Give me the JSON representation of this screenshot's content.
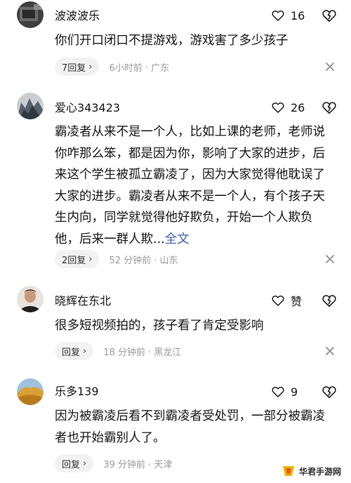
{
  "colors": {
    "text": "#161616",
    "meta": "#9b9b9b",
    "link": "#3b63a8",
    "chip_bg": "#f2f2f2"
  },
  "comments": [
    {
      "username": "波波波乐",
      "avatar_icon": "avatar-photo",
      "like_count": "16",
      "text": "你们开口闭口不提游戏，游戏害了多少孩子",
      "reply_label": "7回复",
      "meta": "6小时前 · 广东"
    },
    {
      "username": "爱心343423",
      "avatar_icon": "avatar-photo",
      "like_count": "26",
      "text": "霸凌者从来不是一个人，比如上课的老师，老师说你咋那么笨，都是因为你，影响了大家的进步，后来这个学生被孤立霸凌了，因为大家觉得他耽误了大家的进步。霸凌者从来不是一个人，有个孩子天生内向，同学就觉得他好欺负，开始一个人欺负他，后来一群人欺...",
      "expand_label": "全文",
      "reply_label": "2回复",
      "meta": "52 分钟前 · 山东"
    },
    {
      "username": "晓辉在东北",
      "avatar_icon": "avatar-photo",
      "like_count": "赞",
      "text": "很多短视频拍的，孩子看了肯定受影响",
      "reply_label": "回复",
      "meta": "18 分钟前 · 黑龙江"
    },
    {
      "username": "乐多139",
      "avatar_icon": "avatar-photo",
      "like_count": "9",
      "text": "因为被霸凌后看不到霸凌者受处罚，一部分被霸凌者也开始霸别人了。",
      "reply_label": "回复",
      "meta": "39 分钟前 · 天津"
    }
  ],
  "watermark": {
    "text": "华君手游网"
  }
}
